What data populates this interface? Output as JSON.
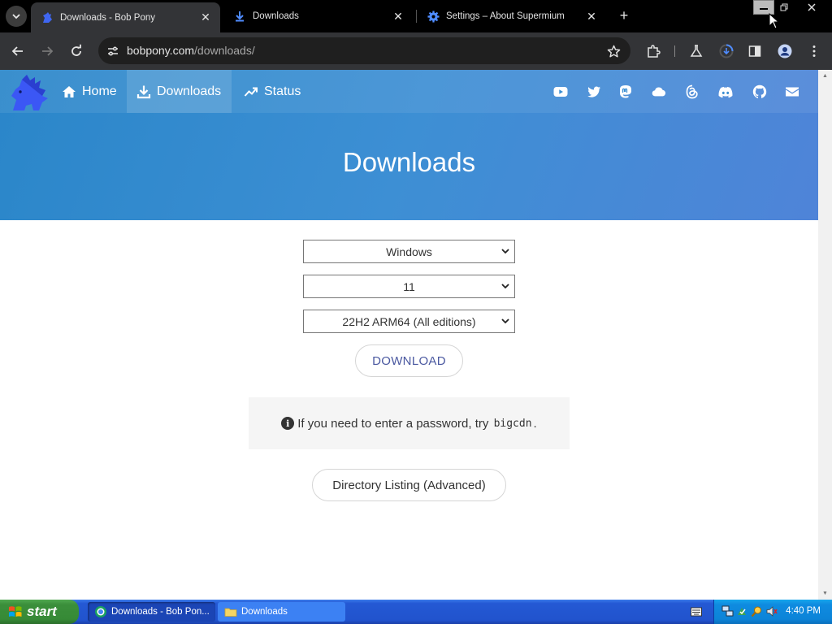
{
  "browser": {
    "tabs": [
      {
        "title": "Downloads - Bob Pony",
        "active": true
      },
      {
        "title": "Downloads",
        "active": false
      },
      {
        "title": "Settings – About Supermium",
        "active": false
      }
    ],
    "url_host": "bobpony.com",
    "url_path": "/downloads/"
  },
  "site": {
    "nav": {
      "home": "Home",
      "downloads": "Downloads",
      "status": "Status"
    },
    "social_icons": [
      "youtube-icon",
      "twitter-icon",
      "mastodon-icon",
      "cloud-icon",
      "threads-icon",
      "discord-icon",
      "github-icon",
      "email-icon"
    ],
    "hero_title": "Downloads",
    "selects": {
      "os": "Windows",
      "version": "11",
      "build": "22H2 ARM64 (All editions)"
    },
    "download_label": "DOWNLOAD",
    "notice": {
      "before": "If you need to enter a password, try",
      "code": "bigcdn",
      "after": "."
    },
    "directory_label": "Directory Listing (Advanced)"
  },
  "taskbar": {
    "start_label": "start",
    "tasks": [
      {
        "label": "Downloads - Bob Pon..."
      },
      {
        "label": "Downloads"
      }
    ],
    "clock": "4:40 PM"
  },
  "colors": {
    "hero_start": "#2a86c9",
    "hero_end": "#4f84d8",
    "download_text": "#4a58a0"
  }
}
